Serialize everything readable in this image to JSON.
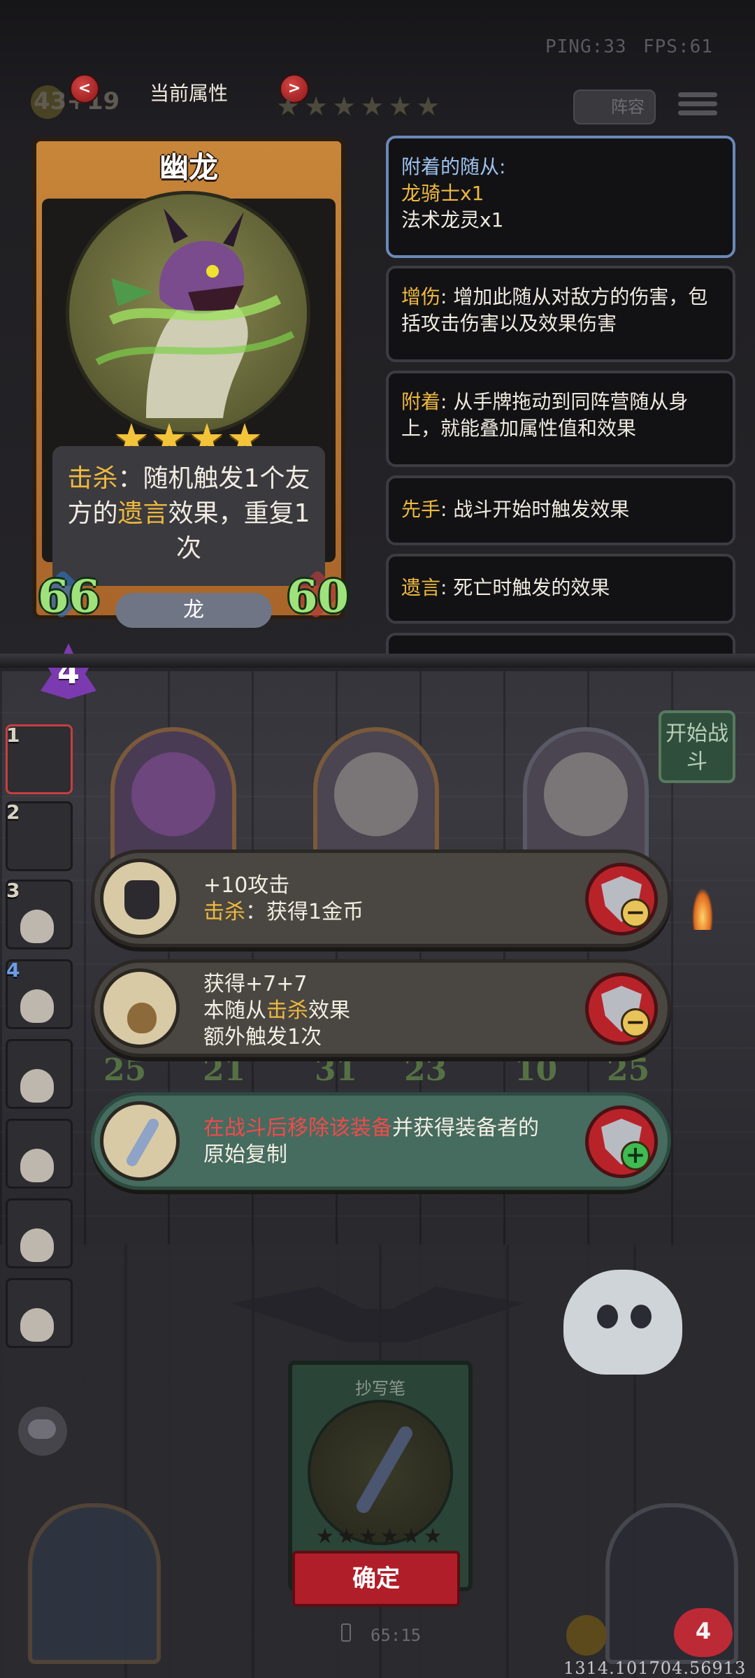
{
  "hud": {
    "ping": "PING:33",
    "fps": "FPS:61",
    "gold": "43",
    "gold_income": "+19",
    "attr_title": "当前属性",
    "prev_label": "<",
    "next_label": ">",
    "lineup_label": "阵容",
    "tavern_stars": "★★★★★★"
  },
  "unit_card": {
    "name": "幽龙",
    "stars": "★★★★",
    "ability_keyword": "击杀",
    "ability_part1": "：随机触发1个友方的",
    "ability_keyword2": "遗言",
    "ability_part2": "效果，重复1次",
    "attack": "66",
    "health": "60",
    "tribe": "龙",
    "tier": "4"
  },
  "panels": {
    "attached_head": "附着的随从:",
    "attached_ally1": "龙骑士x1",
    "attached_ally2": "法术龙灵x1",
    "dmg_kw": "增伤",
    "dmg_text": ": 增加此随从对敌方的伤害，包括攻击伤害以及效果伤害",
    "attach_kw": "附着",
    "attach_text": ": 从手牌拖动到同阵营随从身上，就能叠加属性值和效果",
    "first_kw": "先手",
    "first_text": ": 战斗开始时触发效果",
    "dr_kw": "遗言",
    "dr_text": ": 死亡时触发的效果"
  },
  "board": {
    "start_battle": "开始战斗",
    "slot_numbers": [
      "1",
      "2",
      "3",
      "4"
    ],
    "stats": [
      "25",
      "21",
      "31",
      "23",
      "10",
      "25"
    ]
  },
  "equipment_list": [
    {
      "line1": "+10攻击",
      "kw": "击杀",
      "line2": "：获得1金币",
      "action": "−"
    },
    {
      "line1": "获得+7+7",
      "pre": "本随从",
      "kw": "击杀",
      "post": "效果",
      "line3": "额外触发1次",
      "action": "−"
    },
    {
      "red": "在战斗后移除该装备",
      "rest": "并获得装备者的",
      "line2": "原始复制",
      "action": "+"
    }
  ],
  "selected_equipment": {
    "name": "抄写笔",
    "stars": "★★★★★★",
    "confirm": "确定"
  },
  "footer": {
    "timer": "65:15",
    "lives": "4",
    "build": "1314.101704.56913"
  },
  "colors": {
    "keyword": "#efb93e",
    "warning_red": "#ef4b4b",
    "panel_highlight_border": "#6b89b8",
    "stat_green": "#9fe27c",
    "confirm_red": "#b01e2a"
  }
}
